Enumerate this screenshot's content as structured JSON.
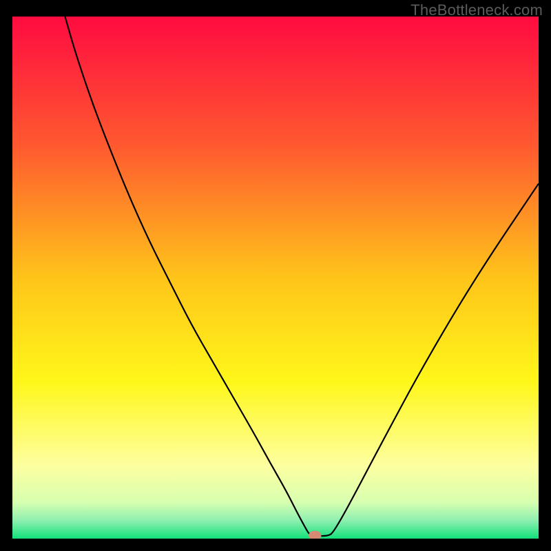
{
  "watermark": "TheBottleneck.com",
  "chart_data": {
    "type": "line",
    "title": "",
    "xlabel": "",
    "ylabel": "",
    "xlim": [
      0,
      100
    ],
    "ylim": [
      0,
      100
    ],
    "grid": false,
    "background_gradient": {
      "stops": [
        {
          "offset": 0.0,
          "color": "#ff0b41"
        },
        {
          "offset": 0.25,
          "color": "#ff5a2f"
        },
        {
          "offset": 0.5,
          "color": "#ffc41a"
        },
        {
          "offset": 0.7,
          "color": "#fff71a"
        },
        {
          "offset": 0.86,
          "color": "#fdffa0"
        },
        {
          "offset": 0.93,
          "color": "#d8ffb0"
        },
        {
          "offset": 0.965,
          "color": "#8ef0b0"
        },
        {
          "offset": 1.0,
          "color": "#13e07a"
        }
      ]
    },
    "series": [
      {
        "name": "bottleneck-curve",
        "color": "#000000",
        "width": 2.2,
        "x": [
          10,
          12,
          15,
          18,
          22,
          26,
          30,
          34,
          38,
          42,
          46,
          49,
          52,
          54,
          55.5,
          56.4,
          57.2,
          60,
          61,
          64,
          70,
          78,
          88,
          100
        ],
        "y": [
          100,
          93,
          84,
          76,
          66,
          57,
          49,
          41,
          34,
          27,
          20,
          14.5,
          9.2,
          5.2,
          2.4,
          0.8,
          0.5,
          0.5,
          1.2,
          6.5,
          18,
          33,
          50,
          68
        ]
      }
    ],
    "marker": {
      "name": "optimal-point",
      "x": 57.5,
      "y": 0.6,
      "rx": 1.2,
      "ry": 0.9,
      "color": "#d58a73"
    }
  }
}
